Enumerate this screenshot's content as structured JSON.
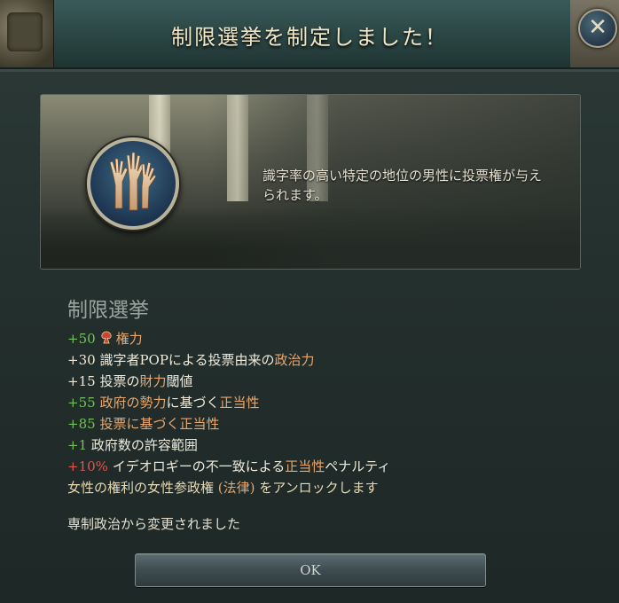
{
  "dialog": {
    "title": "制限選挙を制定しました！",
    "close_glyph": "✕",
    "close_icon": "close-icon",
    "description": "識字率の高い特定の地位の男性に投票権が与えられます。",
    "badge_icon": "raised-hands-icon",
    "law_name": "制限選挙",
    "effects": [
      {
        "value": "+50",
        "icon": "power-icon",
        "text": "権力"
      },
      {
        "value": "+30",
        "prefix": "識字者POPによる投票由来の",
        "highlight": "政治力"
      },
      {
        "value": "+15",
        "prefix": "投票の",
        "highlight": "財力",
        "suffix": "閾値"
      },
      {
        "value": "+55",
        "highlight": "政府の勢力",
        "prefix": "に基づく",
        "highlight2": "正当性"
      },
      {
        "value": "+85",
        "prefix": "投票に基づく",
        "highlight": "正当性"
      },
      {
        "value": "+1",
        "text": "政府数の許容範囲"
      },
      {
        "value": "+10%",
        "prefix": "イデオロギーの不一致による",
        "highlight": "正当性",
        "suffix": "ペナルティ"
      }
    ],
    "unlock_line": {
      "part1": "女性の権利の女性参政権 ",
      "law": "(法律)",
      "part2": " をアンロックします"
    },
    "footer": "専制政治から変更されました",
    "ok_label": "OK"
  },
  "colors": {
    "positive": "#74c15c",
    "highlight": "#e9a66d",
    "negative": "#e0564e",
    "title": "#f0e6c6"
  }
}
